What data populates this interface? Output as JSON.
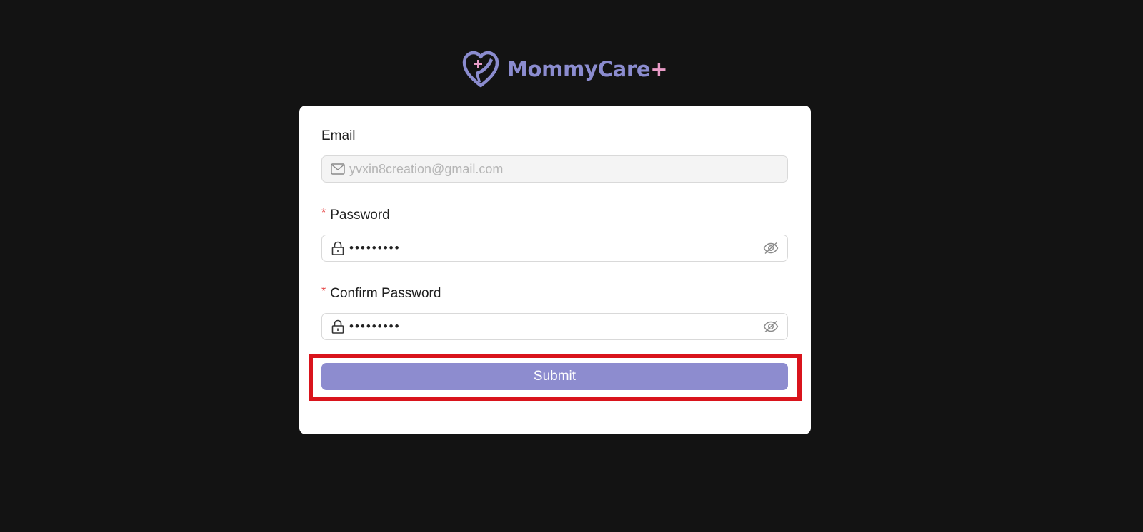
{
  "brand": {
    "name": "MommyCare",
    "plus": "+",
    "logo_icon": "heart-hand-plus-icon"
  },
  "form": {
    "email": {
      "label": "Email",
      "value": "yvxin8creation@gmail.com",
      "icon": "mail-icon",
      "disabled": true
    },
    "password": {
      "label": "Password",
      "required_mark": "*",
      "masked_value": "•••••••••",
      "icon": "lock-icon",
      "toggle_icon": "eye-off-icon"
    },
    "confirm_password": {
      "label": "Confirm Password",
      "required_mark": "*",
      "masked_value": "•••••••••",
      "icon": "lock-icon",
      "toggle_icon": "eye-off-icon"
    },
    "submit_label": "Submit"
  },
  "colors": {
    "background": "#131313",
    "brand": "#8b8ccf",
    "plus": "#e89bc6",
    "accent": "#8d8ccf",
    "highlight": "#d9141c"
  }
}
